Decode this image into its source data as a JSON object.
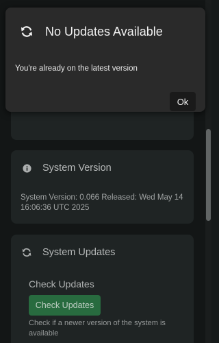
{
  "dialog": {
    "title": "No Updates Available",
    "message": "You're already on the latest version",
    "ok_label": "Ok",
    "icon": "refresh-icon"
  },
  "system_version": {
    "title": "System Version",
    "icon": "info-icon",
    "text": "System Version: 0.066 Released: Wed May 14 16:06:36 UTC 2025"
  },
  "system_updates": {
    "title": "System Updates",
    "icon": "refresh-icon",
    "subheading": "Check Updates",
    "button_label": "Check Updates",
    "help_text": "Check if a newer version of the system is available"
  },
  "colors": {
    "background": "#161a1a",
    "card": "#242929",
    "dialog": "#2a2a2a",
    "accent_green": "#2e7a48"
  }
}
